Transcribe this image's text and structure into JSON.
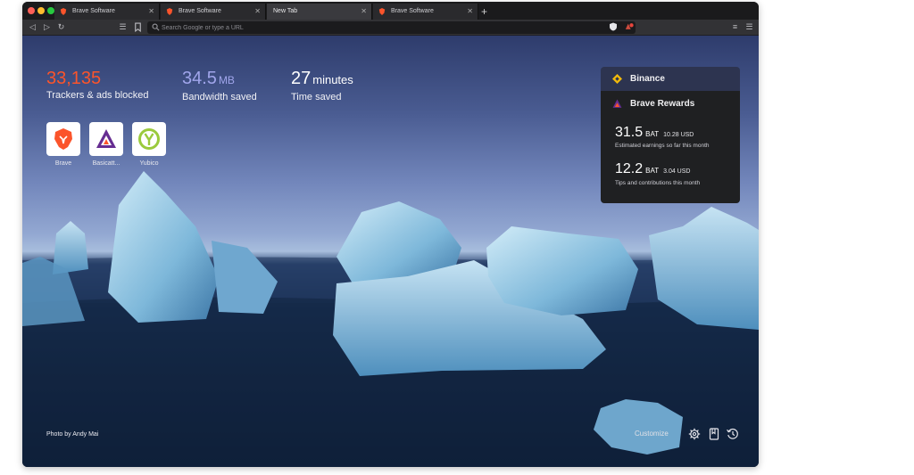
{
  "tabs": [
    {
      "title": "Brave Software",
      "active": false
    },
    {
      "title": "Brave Software",
      "active": false
    },
    {
      "title": "New Tab",
      "active": true
    },
    {
      "title": "Brave Software",
      "active": false
    }
  ],
  "toolbar": {
    "url_placeholder": "Search Google or type a URL",
    "rewards_badge": "1"
  },
  "stats": {
    "trackers": {
      "value": "33,135",
      "label": "Trackers & ads blocked",
      "color": "#fb542b"
    },
    "bandwidth": {
      "value": "34.5",
      "unit": "MB",
      "label": "Bandwidth saved",
      "color": "#a0a5eb"
    },
    "time": {
      "value": "27",
      "unit": "minutes",
      "label": "Time saved",
      "color": "#ffffff"
    }
  },
  "top_sites": [
    {
      "label": "Brave",
      "icon": "brave-lion-icon"
    },
    {
      "label": "Basicatt...",
      "icon": "bat-triangle-icon"
    },
    {
      "label": "Yubico",
      "icon": "yubico-icon"
    }
  ],
  "widgets": {
    "binance": {
      "title": "Binance"
    },
    "rewards": {
      "title": "Brave Rewards",
      "earnings": {
        "amount": "31.5",
        "currency": "BAT",
        "usd": "10.28 USD",
        "desc": "Estimated earnings so far this month"
      },
      "tips": {
        "amount": "12.2",
        "currency": "BAT",
        "usd": "3.04 USD",
        "desc": "Tips and contributions this month"
      }
    }
  },
  "footer": {
    "photo_credit": "Photo by Andy Mai",
    "customize_label": "Customize"
  },
  "colors": {
    "accent_orange": "#fb542b",
    "bat_purple": "#662d91",
    "binance_yellow": "#f0b90b"
  }
}
